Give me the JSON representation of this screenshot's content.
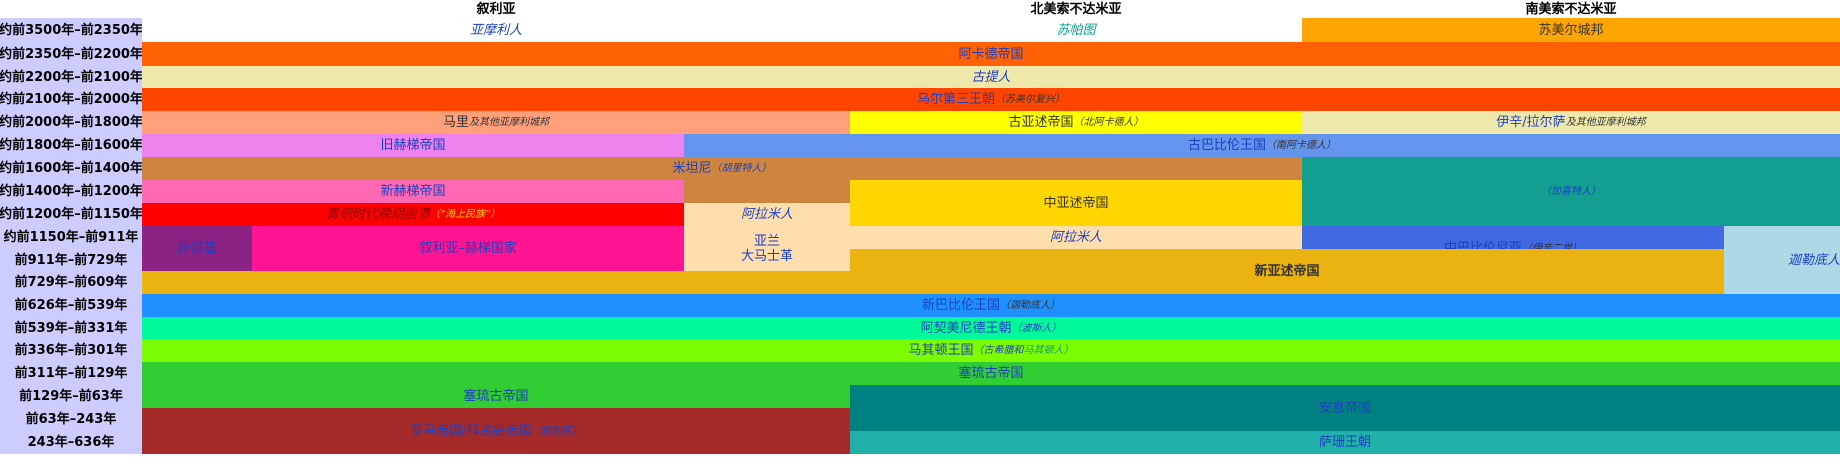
{
  "headers": {
    "syria": "叙利亚",
    "north": "北美索不达米亚",
    "south": "南美索不达米亚"
  },
  "periods": [
    "约前3500年–前2350年",
    "约前2350年–前2200年",
    "约前2200年–前2100年",
    "约前2100年–前2000年",
    "约前2000年–前1800年",
    "约前1800年–前1600年",
    "约前1600年–前1400年",
    "约前1400年–前1200年",
    "约前1200年–前1150年",
    "约前1150年–前911年",
    "前911年–前729年",
    "前729年–前609年",
    "前626年–前539年",
    "前539年–前331年",
    "前336年–前301年",
    "前311年–前129年",
    "前129年–前63年",
    "前63年–243年",
    "243年–636年"
  ],
  "cells": {
    "amorites": "亚摩利人",
    "subarians": "苏帕图",
    "sumer": "苏美尔城邦",
    "akkad": "阿卡德帝国",
    "gutians": "古提人",
    "ur3_main": "乌尔第三王朝",
    "ur3_note": "（苏美尔复兴）",
    "mari_main": "马里",
    "mari_note": "及其他亚摩利城邦",
    "old_assyria_main": "古亚述帝国",
    "old_assyria_note": "（北阿卡德人）",
    "isin_main": "伊辛/拉尔萨",
    "isin_note": "及其他亚摩利城邦",
    "old_hittite": "旧赫梯帝国",
    "old_babylon_main": "古巴比伦王国",
    "old_babylon_note": "（南阿卡德人）",
    "mitanni_main": "米坦尼",
    "mitanni_note": "（胡里特人）",
    "kassite_main": "",
    "kassite_note": "（加喜特人）",
    "new_hittite": "新赫梯帝国",
    "middle_assyria": "中亚述帝国",
    "bronze_main": "青铜时代晚期崩溃",
    "bronze_note": "（“海上民族”）",
    "aramaean1": "阿拉米人",
    "phoenicia": "腓尼基",
    "syro_hittite": "叙利亚–赫梯国家",
    "aram_1": "亚兰",
    "aram_2": "大马士革",
    "aramaean2": "阿拉米人",
    "middle_babylon_main": "中巴比伦尼亚",
    "middle_babylon_note": "（伊辛二世）",
    "chaldeans": "迦勒底人",
    "neo_assyria": "新亚述帝国",
    "neo_babylon_main": "新巴比伦王国",
    "neo_babylon_note": "（迦勒底人）",
    "achaemenid_main": "阿契美尼德王朝",
    "achaemenid_note": "（波斯人）",
    "macedon_main": "马其顿王国",
    "macedon_note1": "（古希腊和",
    "macedon_note2": "马其顿人）",
    "seleucid1": "塞琉古帝国",
    "seleucid2": "塞琉古帝国",
    "roman_main": "罗马帝国/拜占庭帝国",
    "roman_note": "（叙利亚）",
    "parthia": "安息帝国",
    "sasanian": "萨珊王朝"
  },
  "colors": {
    "period_bg": "#ccccff",
    "sumer": "#ffa500",
    "akkad": "#ff6103",
    "gutians": "#eee8aa",
    "ur3": "#ff4500",
    "mari": "#ffa07a",
    "old_assyria": "#ffff00",
    "isin": "#eee8aa",
    "old_hittite": "#ee82ee",
    "old_babylon": "#6495ed",
    "mitanni": "#cd853f",
    "kassite": "#129e91",
    "new_hittite": "#ff69b4",
    "middle_assyria": "#ffd700",
    "bronze": "#ff0000",
    "aramaean": "#ffdead",
    "phoenicia": "#8b2284",
    "syro_hittite": "#ff1493",
    "middle_babylon": "#4169e1",
    "chaldeans": "#add8e6",
    "neo_assyria": "#eab30f",
    "neo_babylon": "#1e90ff",
    "achaemenid": "#00fa9a",
    "macedon": "#7cfc00",
    "seleucid": "#32cd32",
    "roman": "#a52a2a",
    "parthia": "#008080",
    "sasanian": "#20b2aa",
    "blue_text": "#1d3fc0",
    "teal_text": "#0e9e8e"
  }
}
